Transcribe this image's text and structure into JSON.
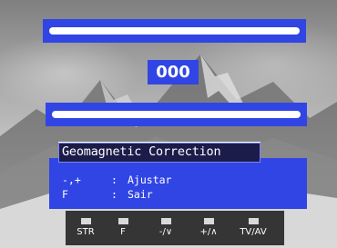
{
  "counter": {
    "value": "000"
  },
  "menu": {
    "title": "Geomagnetic Correction"
  },
  "help": [
    {
      "key": "-,+",
      "sep": ":",
      "action": "Ajustar"
    },
    {
      "key": "F",
      "sep": ":",
      "action": "Sair"
    }
  ],
  "buttons": [
    {
      "label": "STR",
      "icon": "button-icon"
    },
    {
      "label": "F",
      "icon": "button-icon"
    },
    {
      "label": "-/∨",
      "icon": "button-icon"
    },
    {
      "label": "+/∧",
      "icon": "button-icon"
    },
    {
      "label": "TV/AV",
      "icon": "button-icon"
    }
  ],
  "colors": {
    "panel_blue": "#3045e4",
    "title_strip": "#1c1c4a",
    "button_strip": "#353535"
  }
}
